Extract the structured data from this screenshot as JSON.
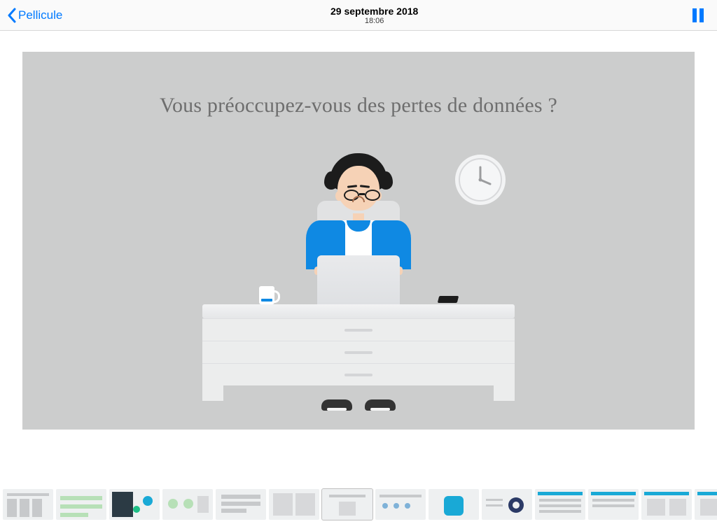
{
  "header": {
    "back_label": "Pellicule",
    "date": "29 septembre 2018",
    "time": "18:06"
  },
  "slide": {
    "question": "Vous préoccupez-vous des pertes de données ?"
  },
  "colors": {
    "ios_blue": "#007aff",
    "accent_blue": "#0f89e3"
  }
}
